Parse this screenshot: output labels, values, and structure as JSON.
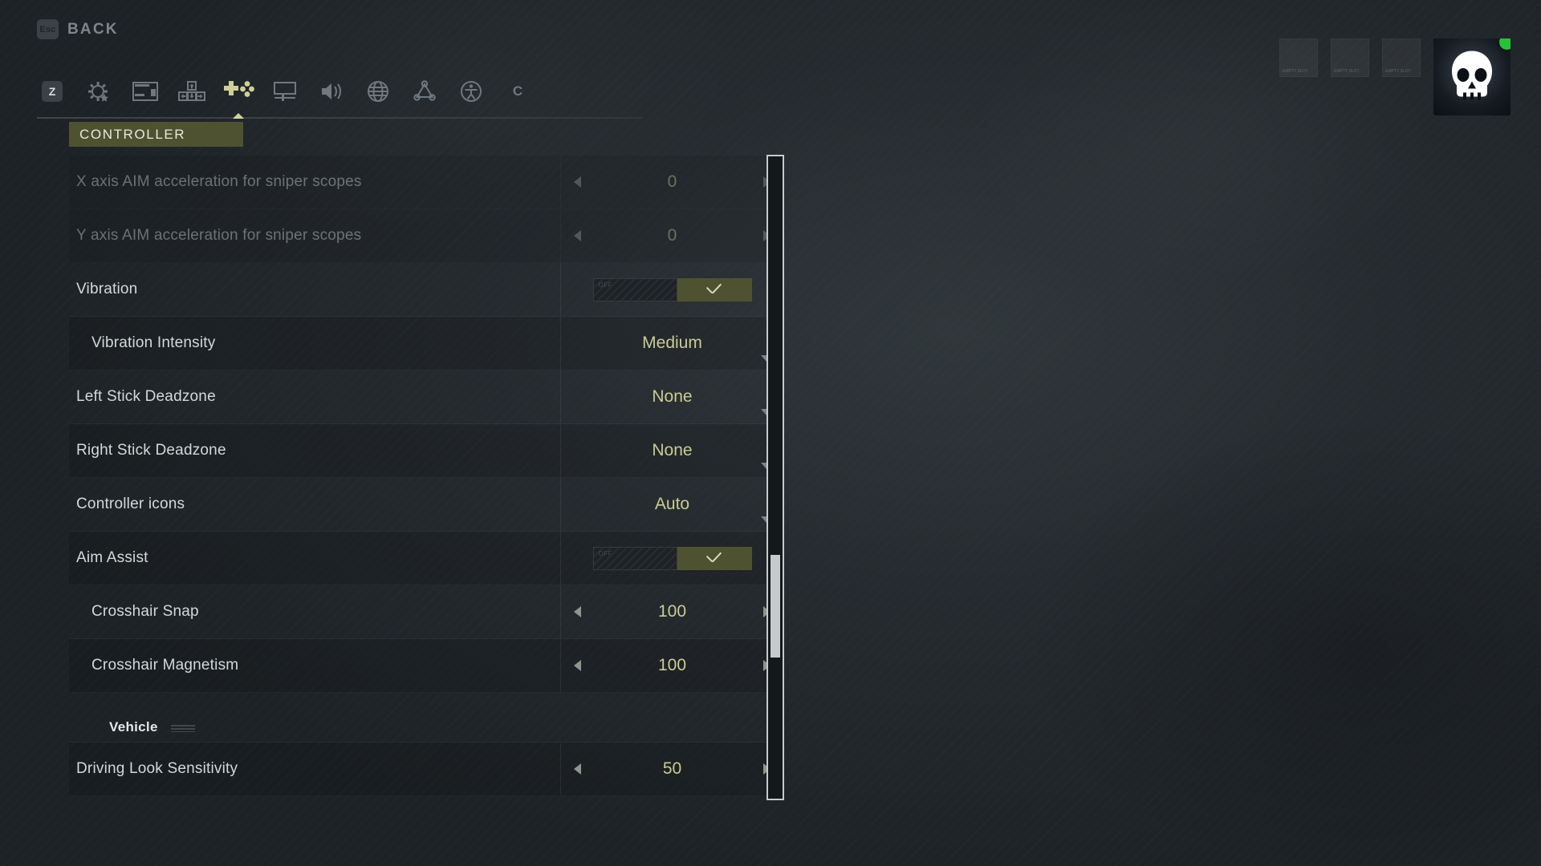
{
  "back": {
    "key": "Esc",
    "label": "BACK"
  },
  "tabs": [
    {
      "name": "keybinds",
      "icon": "z-key-icon",
      "glyph": "Z",
      "active": false
    },
    {
      "name": "gameplay",
      "icon": "gear-star-icon",
      "active": false
    },
    {
      "name": "interface",
      "icon": "layout-panel-icon",
      "active": false
    },
    {
      "name": "keyboard",
      "icon": "wasd-keys-icon",
      "active": false
    },
    {
      "name": "controller",
      "icon": "gamepad-dpad-icon",
      "active": true
    },
    {
      "name": "display",
      "icon": "monitor-icon",
      "active": false
    },
    {
      "name": "audio",
      "icon": "speaker-icon",
      "active": false
    },
    {
      "name": "language",
      "icon": "globe-icon",
      "active": false
    },
    {
      "name": "network",
      "icon": "network-nodes-icon",
      "active": false
    },
    {
      "name": "accessibility",
      "icon": "accessibility-icon",
      "active": false
    },
    {
      "name": "credits",
      "icon": "c-key-icon",
      "glyph": "C",
      "active": false
    }
  ],
  "section": {
    "title": "CONTROLLER"
  },
  "settings": [
    {
      "label": "X axis AIM acceleration for sniper scopes",
      "control": "stepper",
      "value": "0",
      "disabled": true,
      "indent": false
    },
    {
      "label": "Y axis AIM acceleration for sniper scopes",
      "control": "stepper",
      "value": "0",
      "disabled": true,
      "indent": false
    },
    {
      "label": "Vibration",
      "control": "toggle",
      "value": "on",
      "disabled": false,
      "indent": false
    },
    {
      "label": "Vibration Intensity",
      "control": "dropdown",
      "value": "Medium",
      "disabled": false,
      "indent": true
    },
    {
      "label": "Left Stick Deadzone",
      "control": "dropdown",
      "value": "None",
      "disabled": false,
      "indent": false
    },
    {
      "label": "Right Stick Deadzone",
      "control": "dropdown",
      "value": "None",
      "disabled": false,
      "indent": false
    },
    {
      "label": "Controller icons",
      "control": "dropdown",
      "value": "Auto",
      "disabled": false,
      "indent": false
    },
    {
      "label": "Aim Assist",
      "control": "toggle",
      "value": "on",
      "disabled": false,
      "indent": false
    },
    {
      "label": "Crosshair Snap",
      "control": "stepper",
      "value": "100",
      "disabled": false,
      "indent": true
    },
    {
      "label": "Crosshair Magnetism",
      "control": "stepper",
      "value": "100",
      "disabled": false,
      "indent": true
    },
    {
      "label": "Vehicle",
      "control": "group",
      "value": "",
      "disabled": false,
      "indent": false
    },
    {
      "label": "Driving Look Sensitivity",
      "control": "stepper",
      "value": "50",
      "disabled": false,
      "indent": false
    }
  ],
  "toggle_labels": {
    "off": "OFF",
    "on_icon": "checkmark-icon"
  },
  "scrollbar": {
    "thumb_top_pct": 62,
    "thumb_height_pct": 16
  },
  "squad": {
    "slots": [
      {
        "tag": "EMPTY SLOT"
      },
      {
        "tag": "EMPTY SLOT"
      },
      {
        "tag": "EMPTY SLOT"
      }
    ],
    "avatar": {
      "icon": "skull-avatar-icon",
      "status": "online"
    }
  },
  "colors": {
    "accent": "#cdd09a",
    "accent_bg": "#4e5230",
    "value_text": "#c9cc93",
    "online": "#24c436",
    "bg": "#22272b"
  }
}
